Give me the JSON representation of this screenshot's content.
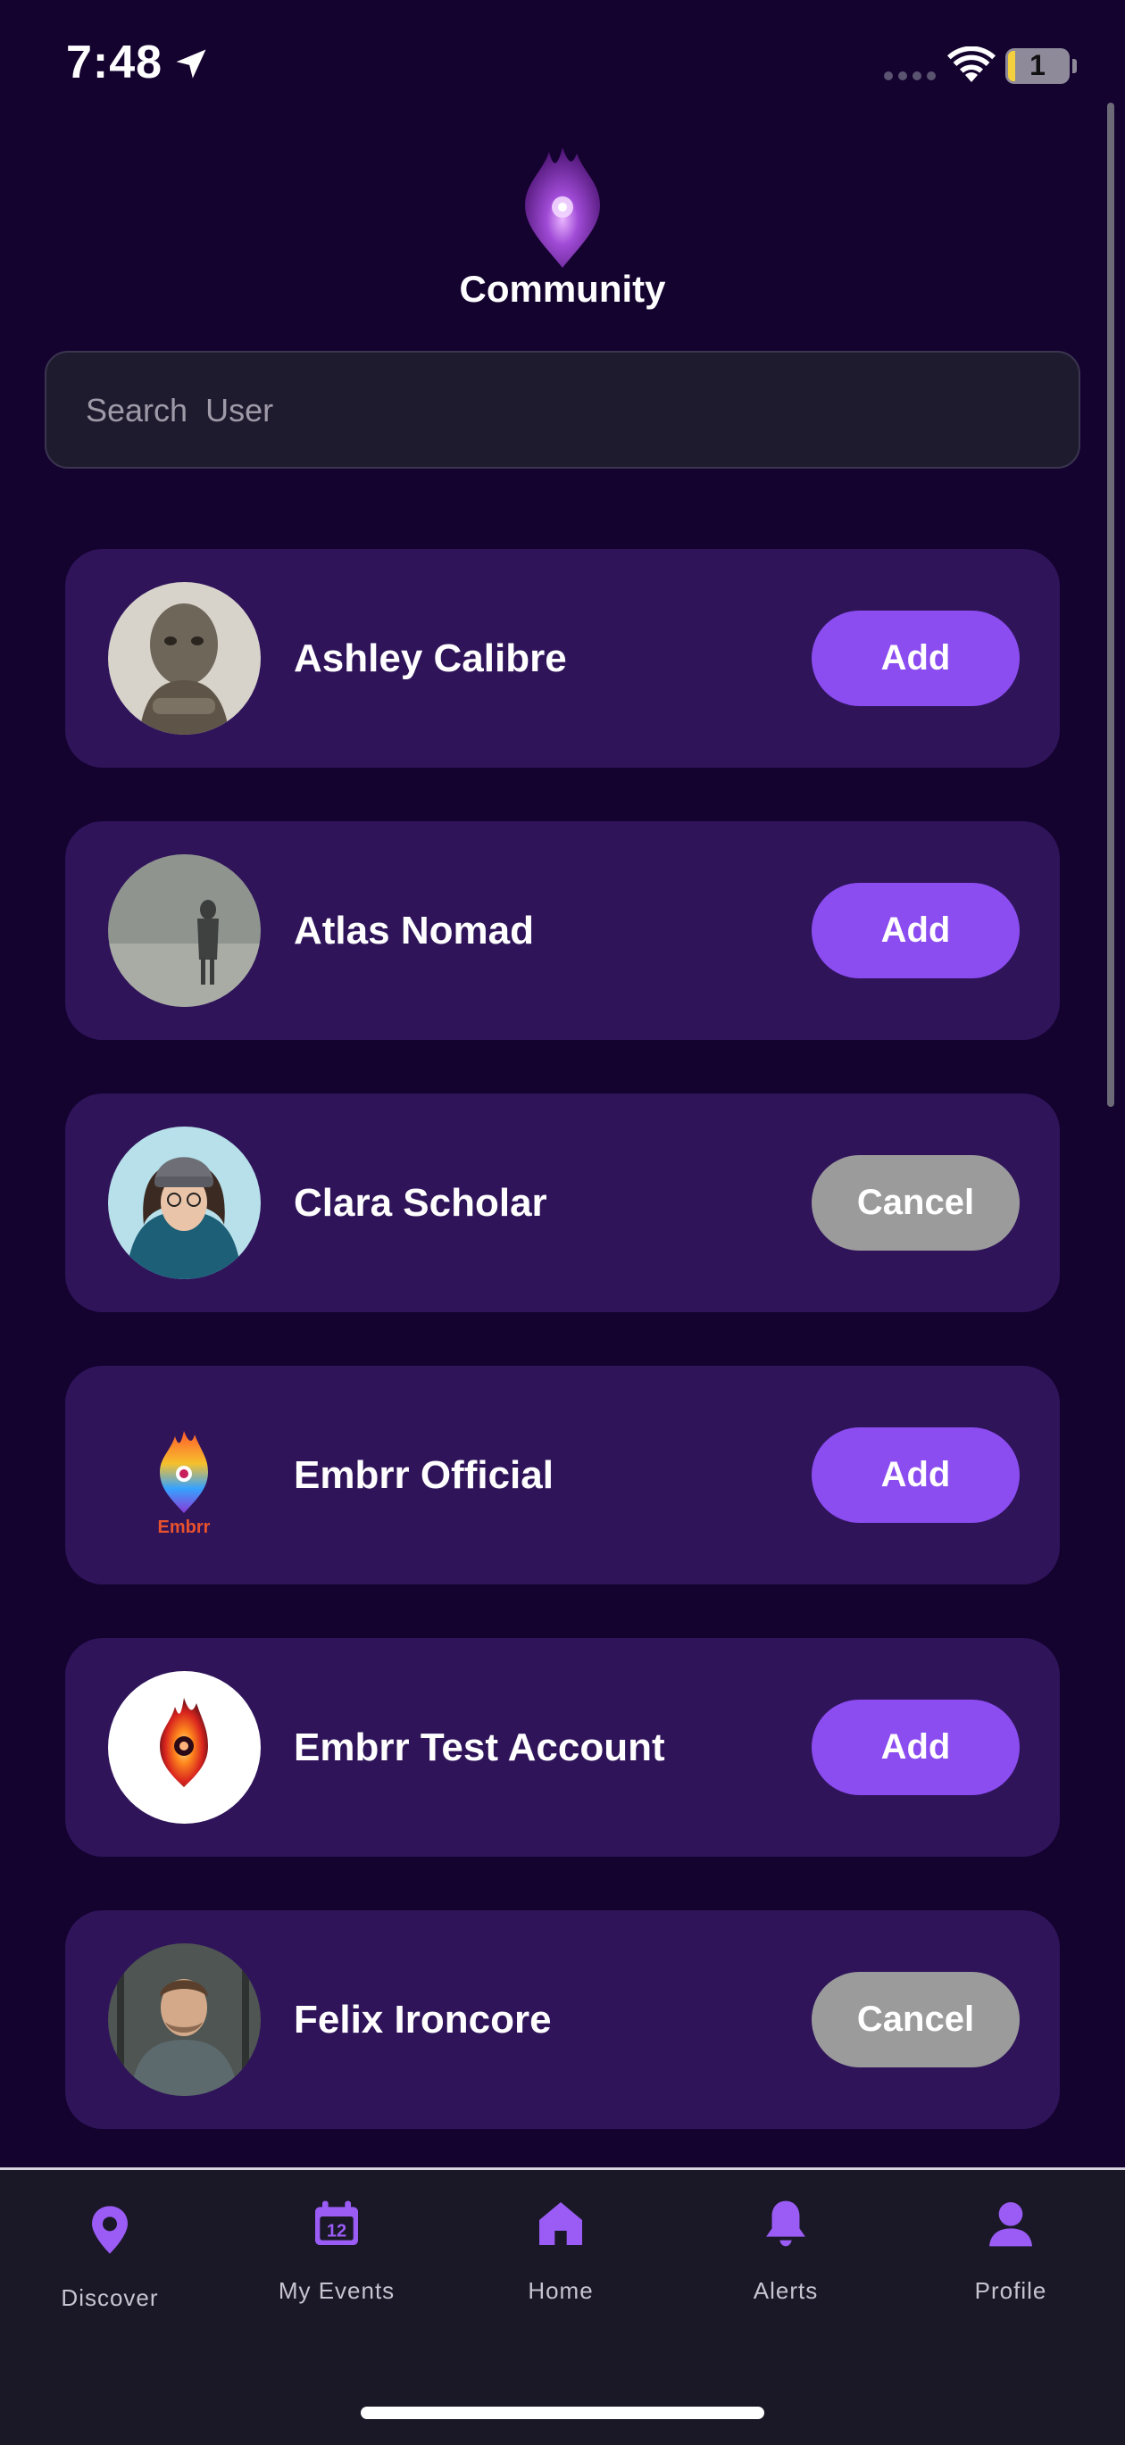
{
  "status_bar": {
    "time": "7:48",
    "battery_level": "1",
    "icons": [
      "location-arrow-icon",
      "signal-icon",
      "wifi-icon",
      "battery-icon"
    ]
  },
  "header": {
    "title": "Community",
    "logo": "flame-logo"
  },
  "search": {
    "placeholder": "Search  User",
    "value": ""
  },
  "users": [
    {
      "name": "Ashley Calibre",
      "action": "Add",
      "avatar": "carved-statue-photo"
    },
    {
      "name": "Atlas Nomad",
      "action": "Add",
      "avatar": "figure-in-fog-photo"
    },
    {
      "name": "Clara Scholar",
      "action": "Cancel",
      "avatar": "woman-beanie-photo"
    },
    {
      "name": "Embrr Official",
      "action": "Add",
      "avatar": "embrr-logo"
    },
    {
      "name": "Embrr Test Account",
      "action": "Add",
      "avatar": "embrr-flame-logo"
    },
    {
      "name": "Felix Ironcore",
      "action": "Cancel",
      "avatar": "man-gym-photo"
    }
  ],
  "tabs": [
    {
      "label": "Discover",
      "icon": "map-pin-icon",
      "active": true
    },
    {
      "label": "My Events",
      "icon": "calendar-icon",
      "badge": "12"
    },
    {
      "label": "Home",
      "icon": "home-icon"
    },
    {
      "label": "Alerts",
      "icon": "bell-icon"
    },
    {
      "label": "Profile",
      "icon": "user-icon"
    }
  ],
  "colors": {
    "background": "#14022f",
    "card": "#2f145a",
    "accent": "#8b4cf0",
    "cancel": "#9b9b9b",
    "tab_bar": "#1a1827"
  }
}
